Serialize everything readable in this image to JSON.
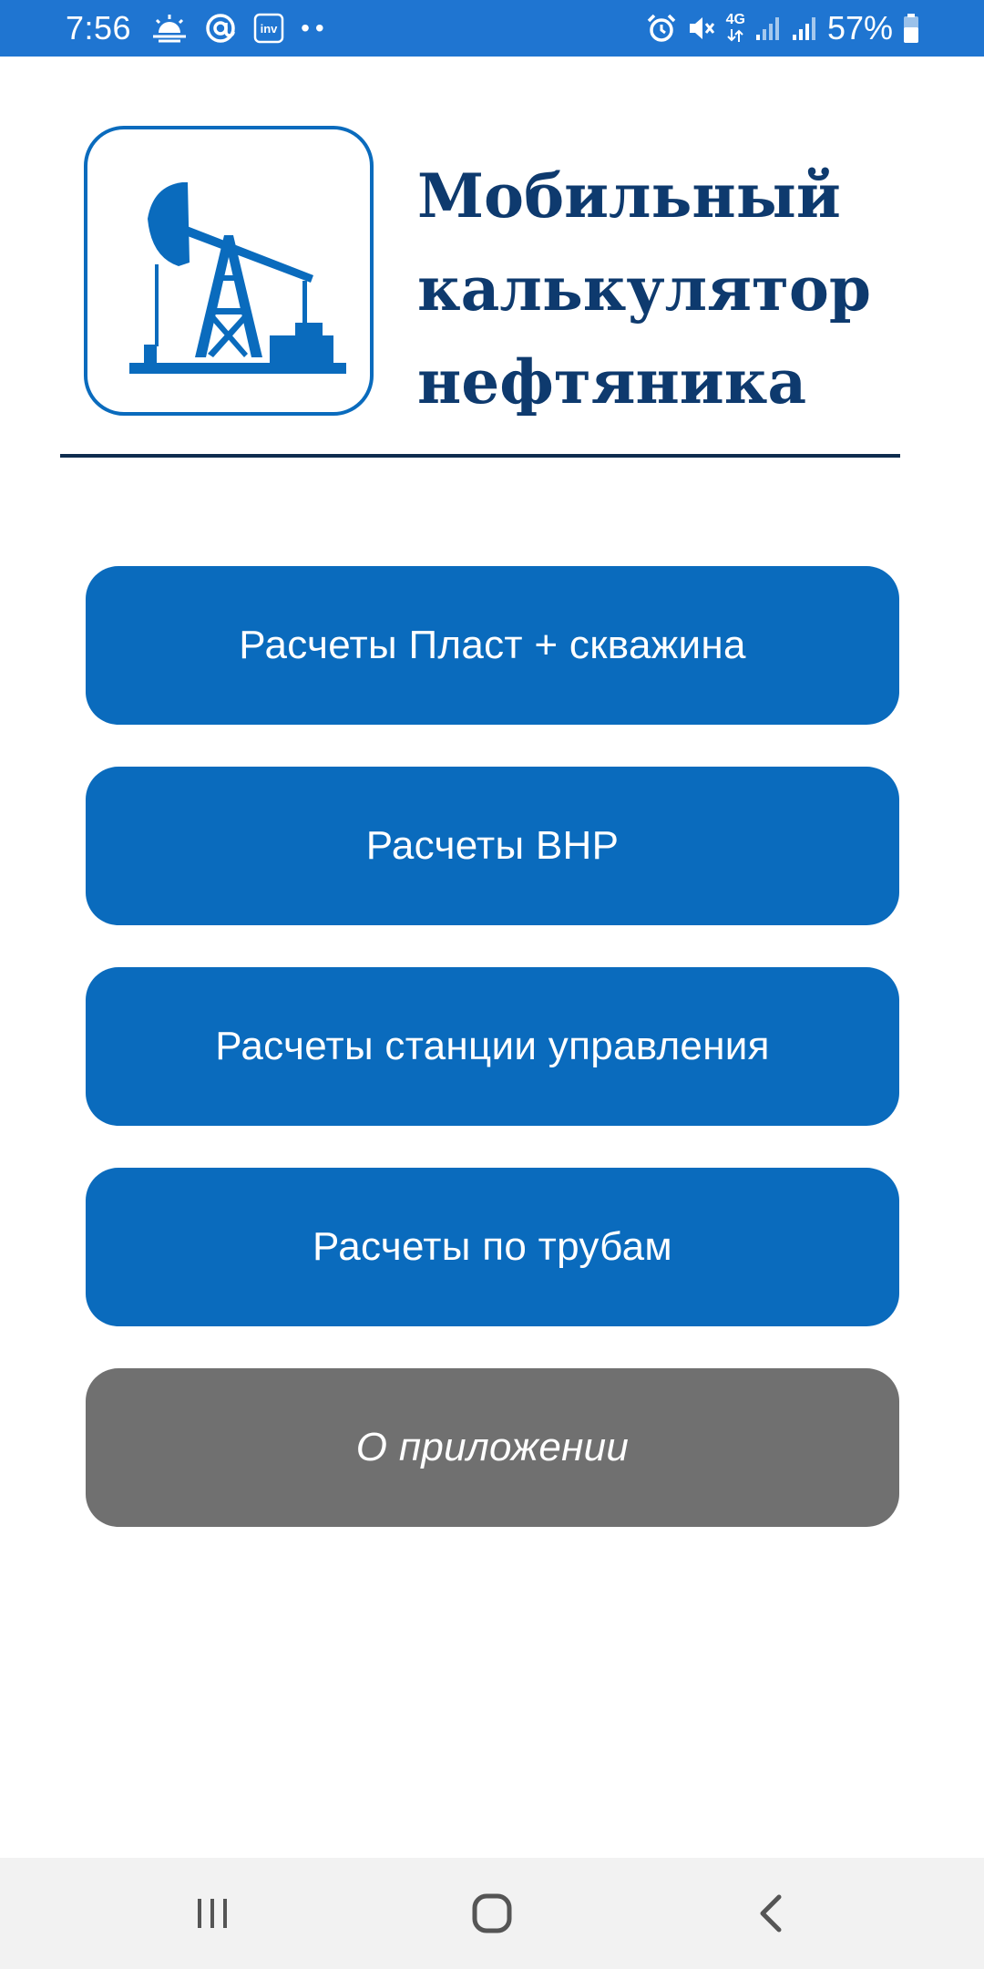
{
  "status_bar": {
    "time": "7:56",
    "battery_percent": "57%",
    "network": "4G",
    "inv_badge": "inv",
    "more_notifications": "••",
    "icons": [
      "weather-sun-icon",
      "at-sign-icon",
      "inv-app-icon",
      "alarm-icon",
      "mute-icon",
      "network-4g-icon",
      "signal-icon",
      "signal-icon",
      "battery-icon"
    ]
  },
  "header": {
    "title_lines": [
      "Мобильный",
      "калькулятор",
      "нефтяника"
    ],
    "logo_icon": "oil-pump-jack-icon"
  },
  "menu": {
    "items": [
      {
        "label": "Расчеты Пласт + скважина",
        "color": "#0a6bbd"
      },
      {
        "label": "Расчеты ВНР",
        "color": "#0a6bbd"
      },
      {
        "label": "Расчеты станции управления",
        "color": "#0a6bbd"
      },
      {
        "label": "Расчеты по трубам",
        "color": "#0a6bbd"
      },
      {
        "label": "О приложении",
        "color": "#707070"
      }
    ]
  },
  "nav_bar": {
    "icons": [
      "recent-apps-icon",
      "home-icon",
      "back-icon"
    ]
  },
  "colors": {
    "status_bar": "#1f75d1",
    "primary": "#0a6bbd",
    "title": "#0e3a6e",
    "secondary": "#707070"
  }
}
